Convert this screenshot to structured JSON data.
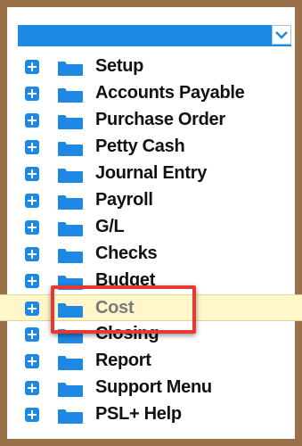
{
  "menu": {
    "items": [
      {
        "label": "Setup"
      },
      {
        "label": "Accounts Payable"
      },
      {
        "label": "Purchase Order"
      },
      {
        "label": "Petty Cash"
      },
      {
        "label": "Journal Entry"
      },
      {
        "label": "Payroll"
      },
      {
        "label": "G/L"
      },
      {
        "label": "Checks"
      },
      {
        "label": "Budget"
      },
      {
        "label": "Cost"
      },
      {
        "label": "Closing"
      },
      {
        "label": "Report"
      },
      {
        "label": "Support Menu"
      },
      {
        "label": "PSL+ Help"
      }
    ],
    "highlighted": "Cost"
  },
  "colors": {
    "frame": "#9a7048",
    "header_bar": "#1e88e5",
    "expand_icon": "#1e88e5",
    "folder_icon": "#1e88e5",
    "highlight_row": "#fff6c9",
    "annotation_box": "#e53935"
  },
  "icons": {
    "dropdown": "chevron-down-icon",
    "expand": "plus-box-icon",
    "folder": "folder-icon"
  }
}
